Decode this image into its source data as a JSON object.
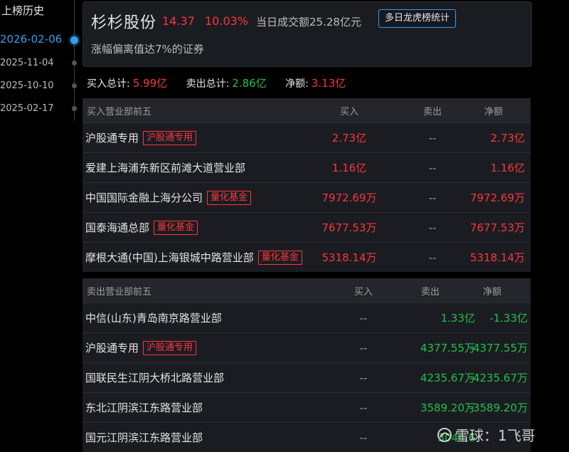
{
  "history": {
    "title": "上榜历史",
    "dates": [
      {
        "label": "2026-02-06",
        "active": true
      },
      {
        "label": "2025-11-04",
        "active": false
      },
      {
        "label": "2025-10-10",
        "active": false
      },
      {
        "label": "2025-02-17",
        "active": false
      }
    ]
  },
  "stock": {
    "name": "杉杉股份",
    "price": "14.37",
    "change_pct": "10.03%",
    "turnover": "当日成交额25.28亿元",
    "multi_day_button": "多日龙虎榜统计",
    "reason": "涨幅偏离值达7%的证券"
  },
  "totals": {
    "buy_label": "买入总计:",
    "buy_value": "5.99亿",
    "sell_label": "卖出总计:",
    "sell_value": "2.86亿",
    "net_label": "净额:",
    "net_value": "3.13亿"
  },
  "buy_table": {
    "headers": {
      "name": "买入营业部前五",
      "buy": "买入",
      "sell": "卖出",
      "net": "净额"
    },
    "rows": [
      {
        "name": "沪股通专用",
        "tag": "沪股通专用",
        "buy": "2.73亿",
        "sell": "--",
        "net": "2.73亿"
      },
      {
        "name": "爱建上海浦东新区前滩大道营业部",
        "tag": "",
        "buy": "1.16亿",
        "sell": "--",
        "net": "1.16亿"
      },
      {
        "name": "中国国际金融上海分公司",
        "tag": "量化基金",
        "buy": "7972.69万",
        "sell": "--",
        "net": "7972.69万"
      },
      {
        "name": "国泰海通总部",
        "tag": "量化基金",
        "buy": "7677.53万",
        "sell": "--",
        "net": "7677.53万"
      },
      {
        "name": "摩根大通(中国)上海银城中路营业部",
        "tag": "量化基金",
        "buy": "5318.14万",
        "sell": "--",
        "net": "5318.14万"
      }
    ]
  },
  "sell_table": {
    "headers": {
      "name": "卖出营业部前五",
      "buy": "买入",
      "sell": "卖出",
      "net": "净额"
    },
    "rows": [
      {
        "name": "中信(山东)青岛南京路营业部",
        "tag": "",
        "buy": "--",
        "sell": "1.33亿",
        "net": "-1.33亿"
      },
      {
        "name": "沪股通专用",
        "tag": "沪股通专用",
        "buy": "--",
        "sell": "4377.55万",
        "net": "-4377.55万"
      },
      {
        "name": "国联民生江阴大桥北路营业部",
        "tag": "",
        "buy": "--",
        "sell": "4235.67万",
        "net": "-4235.67万"
      },
      {
        "name": "东北江阴滨江东路营业部",
        "tag": "",
        "buy": "--",
        "sell": "3589.20万",
        "net": "-3589.20万"
      },
      {
        "name": "国元江阴滨江东路营业部",
        "tag": "",
        "buy": "--",
        "sell": "3044.6",
        "net": ""
      }
    ]
  },
  "watermark": {
    "logo_icon": "snowball-logo-icon",
    "text": "雪球：1飞哥"
  },
  "colors": {
    "up": "#f5383c",
    "down": "#21c04a",
    "accent": "#3a9bf0"
  }
}
